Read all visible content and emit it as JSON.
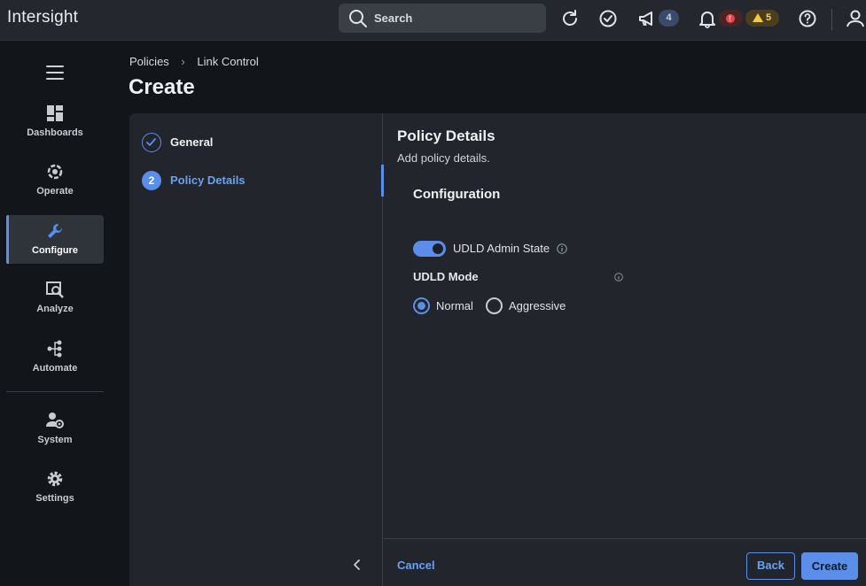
{
  "app": {
    "title": "Intersight"
  },
  "header": {
    "search_placeholder": "Search",
    "notifications_count": "4",
    "alarms_warning_count": "5"
  },
  "sidebar": {
    "items": [
      {
        "label": "Dashboards",
        "icon": "dashboards-icon"
      },
      {
        "label": "Operate",
        "icon": "operate-icon"
      },
      {
        "label": "Configure",
        "icon": "configure-icon",
        "active": true
      },
      {
        "label": "Analyze",
        "icon": "analyze-icon"
      },
      {
        "label": "Automate",
        "icon": "automate-icon"
      },
      {
        "label": "System",
        "icon": "system-icon"
      },
      {
        "label": "Settings",
        "icon": "settings-icon"
      }
    ]
  },
  "breadcrumb": {
    "items": [
      "Policies",
      "Link Control"
    ]
  },
  "page": {
    "title": "Create"
  },
  "wizard": {
    "steps": [
      {
        "number": "1",
        "label": "General",
        "state": "complete"
      },
      {
        "number": "2",
        "label": "Policy Details",
        "state": "current"
      }
    ],
    "section_title": "Policy Details",
    "section_subtitle": "Add policy details.",
    "config_title": "Configuration",
    "udld_admin_state_label": "UDLD Admin State",
    "udld_admin_state_on": true,
    "udld_mode_label": "UDLD Mode",
    "udld_mode_options": [
      "Normal",
      "Aggressive"
    ],
    "udld_mode_selected": "Normal",
    "cancel_label": "Cancel",
    "back_label": "Back",
    "create_label": "Create"
  },
  "colors": {
    "accent": "#5a8ee8",
    "background": "#121519",
    "panel": "#22262c"
  }
}
